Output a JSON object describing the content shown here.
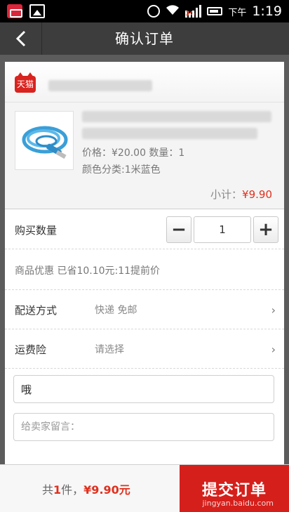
{
  "status_bar": {
    "network": "3G",
    "time_prefix": "下午",
    "time": "1:19"
  },
  "navbar": {
    "title": "确认订单"
  },
  "shop": {
    "badge": "天猫"
  },
  "product": {
    "price_line": "价格：¥20.00  数量：1",
    "color_line": "颜色分类:1米蓝色",
    "subtotal_label": "小计：",
    "subtotal_value": "¥9.90"
  },
  "quantity": {
    "label": "购买数量",
    "minus": "−",
    "value": "1",
    "plus": "+"
  },
  "promo": {
    "text": "商品优惠 已省10.10元:11提前价"
  },
  "shipping": {
    "label": "配送方式",
    "value": "快递 免邮",
    "chevron": "›"
  },
  "insurance": {
    "label": "运费险",
    "value": "请选择",
    "chevron": "›"
  },
  "fields": {
    "name_value": "哦",
    "message_placeholder": "给卖家留言："
  },
  "bottom": {
    "total_prefix": "共",
    "total_count": "1",
    "total_middle": "件，",
    "total_amount": "¥9.90元",
    "submit_label": "提交订单",
    "watermark": "jingyan.baidu.com"
  },
  "colors": {
    "accent": "#d51f1b",
    "price": "#e0301e",
    "navbar": "#3d3d3d"
  }
}
